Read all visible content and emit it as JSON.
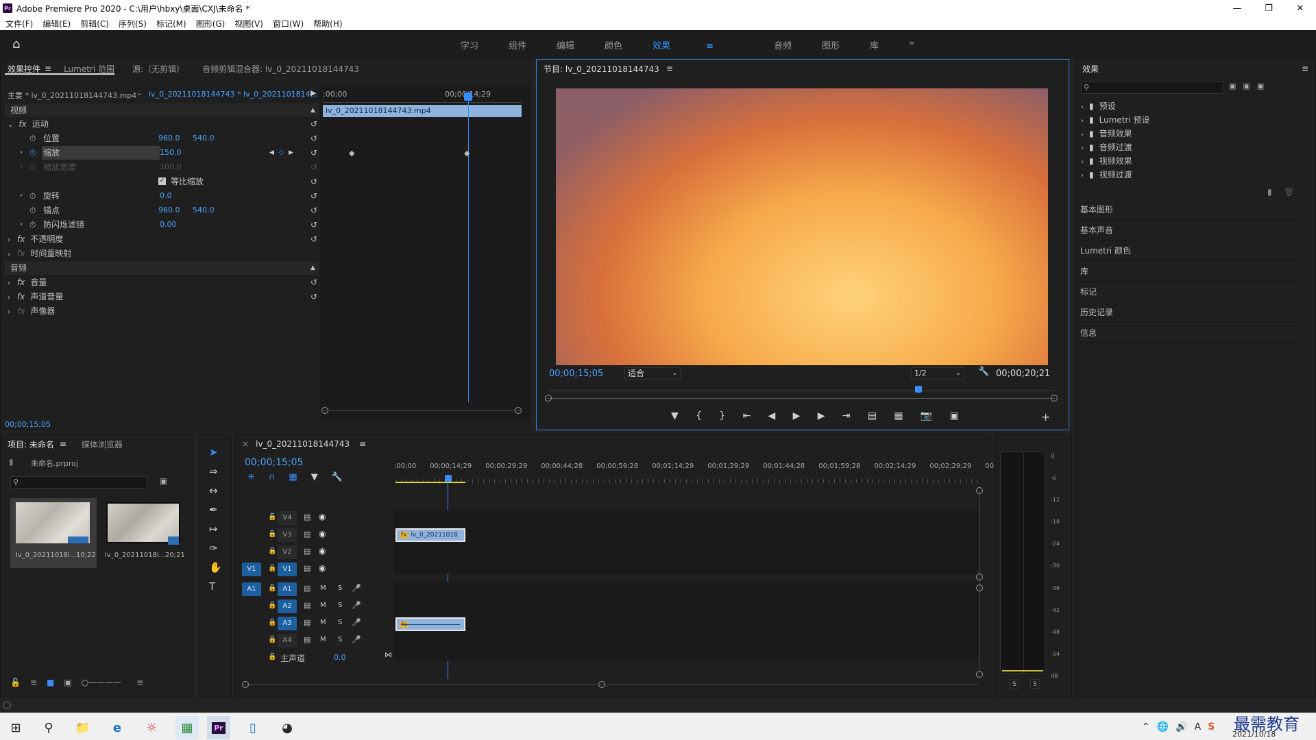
{
  "window": {
    "title": "Adobe Premiere Pro 2020 - C:\\用户\\hbxy\\桌面\\CXJ\\未命名 *",
    "logo": "Pr"
  },
  "menu": [
    "文件(F)",
    "编辑(E)",
    "剪辑(C)",
    "序列(S)",
    "标记(M)",
    "图形(G)",
    "视图(V)",
    "窗口(W)",
    "帮助(H)"
  ],
  "workspaces": [
    "学习",
    "组件",
    "编辑",
    "颜色",
    "效果",
    "音频",
    "图形",
    "库"
  ],
  "workspace_active": "效果",
  "effect_controls": {
    "tabs": [
      "效果控件",
      "Lumetri 范围",
      "源:（无剪辑）",
      "音频剪辑混合器: lv_0_20211018144743"
    ],
    "master": "主要 * lv_0_20211018144743.mp4",
    "sequence": "lv_0_20211018144743 * lv_0_2021101814...",
    "ruler_start": ";00;00",
    "ruler_mark": "00;00;14;29",
    "clip_name": "lv_0_20211018144743.mp4",
    "video_label": "视频",
    "motion": "运动",
    "position": "位置",
    "pos_x": "960.0",
    "pos_y": "540.0",
    "scale": "缩放",
    "scale_val": "150.0",
    "scale_width": "缩放宽度",
    "scale_width_val": "100.0",
    "uniform": "等比缩放",
    "rotation": "旋转",
    "rotation_val": "0.0",
    "anchor": "锚点",
    "anchor_x": "960.0",
    "anchor_y": "540.0",
    "antiflicker": "防闪烁滤镜",
    "antiflicker_val": "0.00",
    "opacity": "不透明度",
    "time_remap": "时间重映射",
    "audio_label": "音频",
    "volume": "音量",
    "channel_volume": "声道音量",
    "panner": "声像器",
    "timecode": "00;00;15;05"
  },
  "program": {
    "title": "节目: lv_0_20211018144743",
    "timecode_left": "00;00;15;05",
    "fit": "适合",
    "quality": "1/2",
    "timecode_right": "00;00;20;21"
  },
  "effects_panel": {
    "title": "效果",
    "folders": [
      "预设",
      "Lumetri 预设",
      "音频效果",
      "音频过渡",
      "视频效果",
      "视频过渡"
    ],
    "sections": [
      "基本图形",
      "基本声音",
      "Lumetri 颜色",
      "库",
      "标记",
      "历史记录",
      "信息"
    ]
  },
  "project": {
    "tabs": [
      "项目: 未命名",
      "媒体浏览器"
    ],
    "file": "未命名.prproj",
    "items": [
      {
        "name": "lv_0_20211018l...",
        "duration": "10;22"
      },
      {
        "name": "lv_0_20211018l...",
        "duration": "20;21"
      }
    ]
  },
  "timeline": {
    "tab": "lv_0_20211018144743",
    "timecode": "00;00;15;05",
    "ruler": [
      ":00;00",
      "00;00;14;29",
      "00;00;29;29",
      "00;00;44;28",
      "00;00;59;28",
      "00;01;14;29",
      "00;01;29;29",
      "00;01;44;28",
      "00;01;59;28",
      "00;02;14;29",
      "00;02;29;29",
      "00;02;44;"
    ],
    "video_tracks": [
      "V4",
      "V3",
      "V2",
      "V1"
    ],
    "audio_tracks": [
      "A1",
      "A2",
      "A3",
      "A4"
    ],
    "src_v": "V1",
    "src_a": "A1",
    "m": "M",
    "s": "S",
    "master": "主声道",
    "master_val": "0.0",
    "clip_label": "lv_0_20211018"
  },
  "meter": {
    "scale": [
      "0",
      "-6",
      "-12",
      "-18",
      "-24",
      "-30",
      "-36",
      "-42",
      "-48",
      "-54",
      "dB"
    ],
    "solo": [
      "S",
      "S"
    ]
  },
  "taskbar": {
    "date": "2021/10/18",
    "watermark": "最需教育"
  }
}
